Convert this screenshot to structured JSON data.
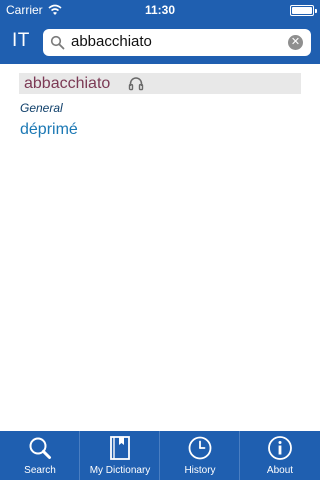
{
  "status_bar": {
    "carrier": "Carrier",
    "time": "11:30",
    "battery_percent": 100
  },
  "header": {
    "language_code": "IT",
    "search": {
      "value": "abbacchiato",
      "placeholder": "",
      "search_icon": "search-icon",
      "clear_icon": "clear-icon"
    }
  },
  "entry": {
    "headword": "abbacchiato",
    "audio_icon": "headphones-icon",
    "category": "General",
    "translation": "déprimé"
  },
  "tabbar": {
    "tabs": [
      {
        "label": "Search",
        "icon": "search-icon"
      },
      {
        "label": "My Dictionary",
        "icon": "book-icon"
      },
      {
        "label": "History",
        "icon": "clock-icon"
      },
      {
        "label": "About",
        "icon": "info-icon"
      }
    ]
  },
  "colors": {
    "brand_blue": "#1f5fb0",
    "headword": "#7c3a55",
    "translation": "#1b78b4",
    "category": "#0f3f6a"
  }
}
